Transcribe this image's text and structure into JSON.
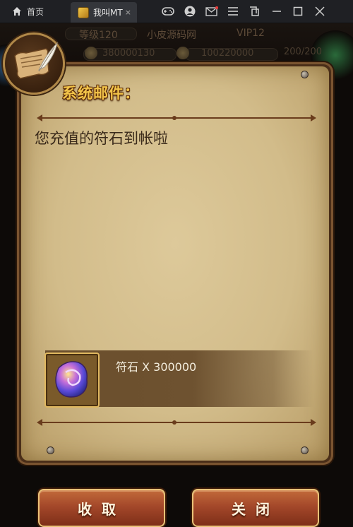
{
  "titlebar": {
    "home_label": "首页",
    "tab_label": "我叫MT",
    "tab_close": "×"
  },
  "hud": {
    "level": "等级120",
    "site": "小皮源码网",
    "vip": "VIP12",
    "gems": "380000130",
    "gold": "100220000",
    "stamina": "200/200"
  },
  "mail": {
    "title": "系统邮件：",
    "message": "您充值的符石到帐啦",
    "reward_text": "符石 X 300000"
  },
  "buttons": {
    "collect": "收取",
    "close": "关闭"
  },
  "colors": {
    "title": "#f3c54a",
    "parchment": "#d8c494",
    "button": "#a4482a"
  }
}
